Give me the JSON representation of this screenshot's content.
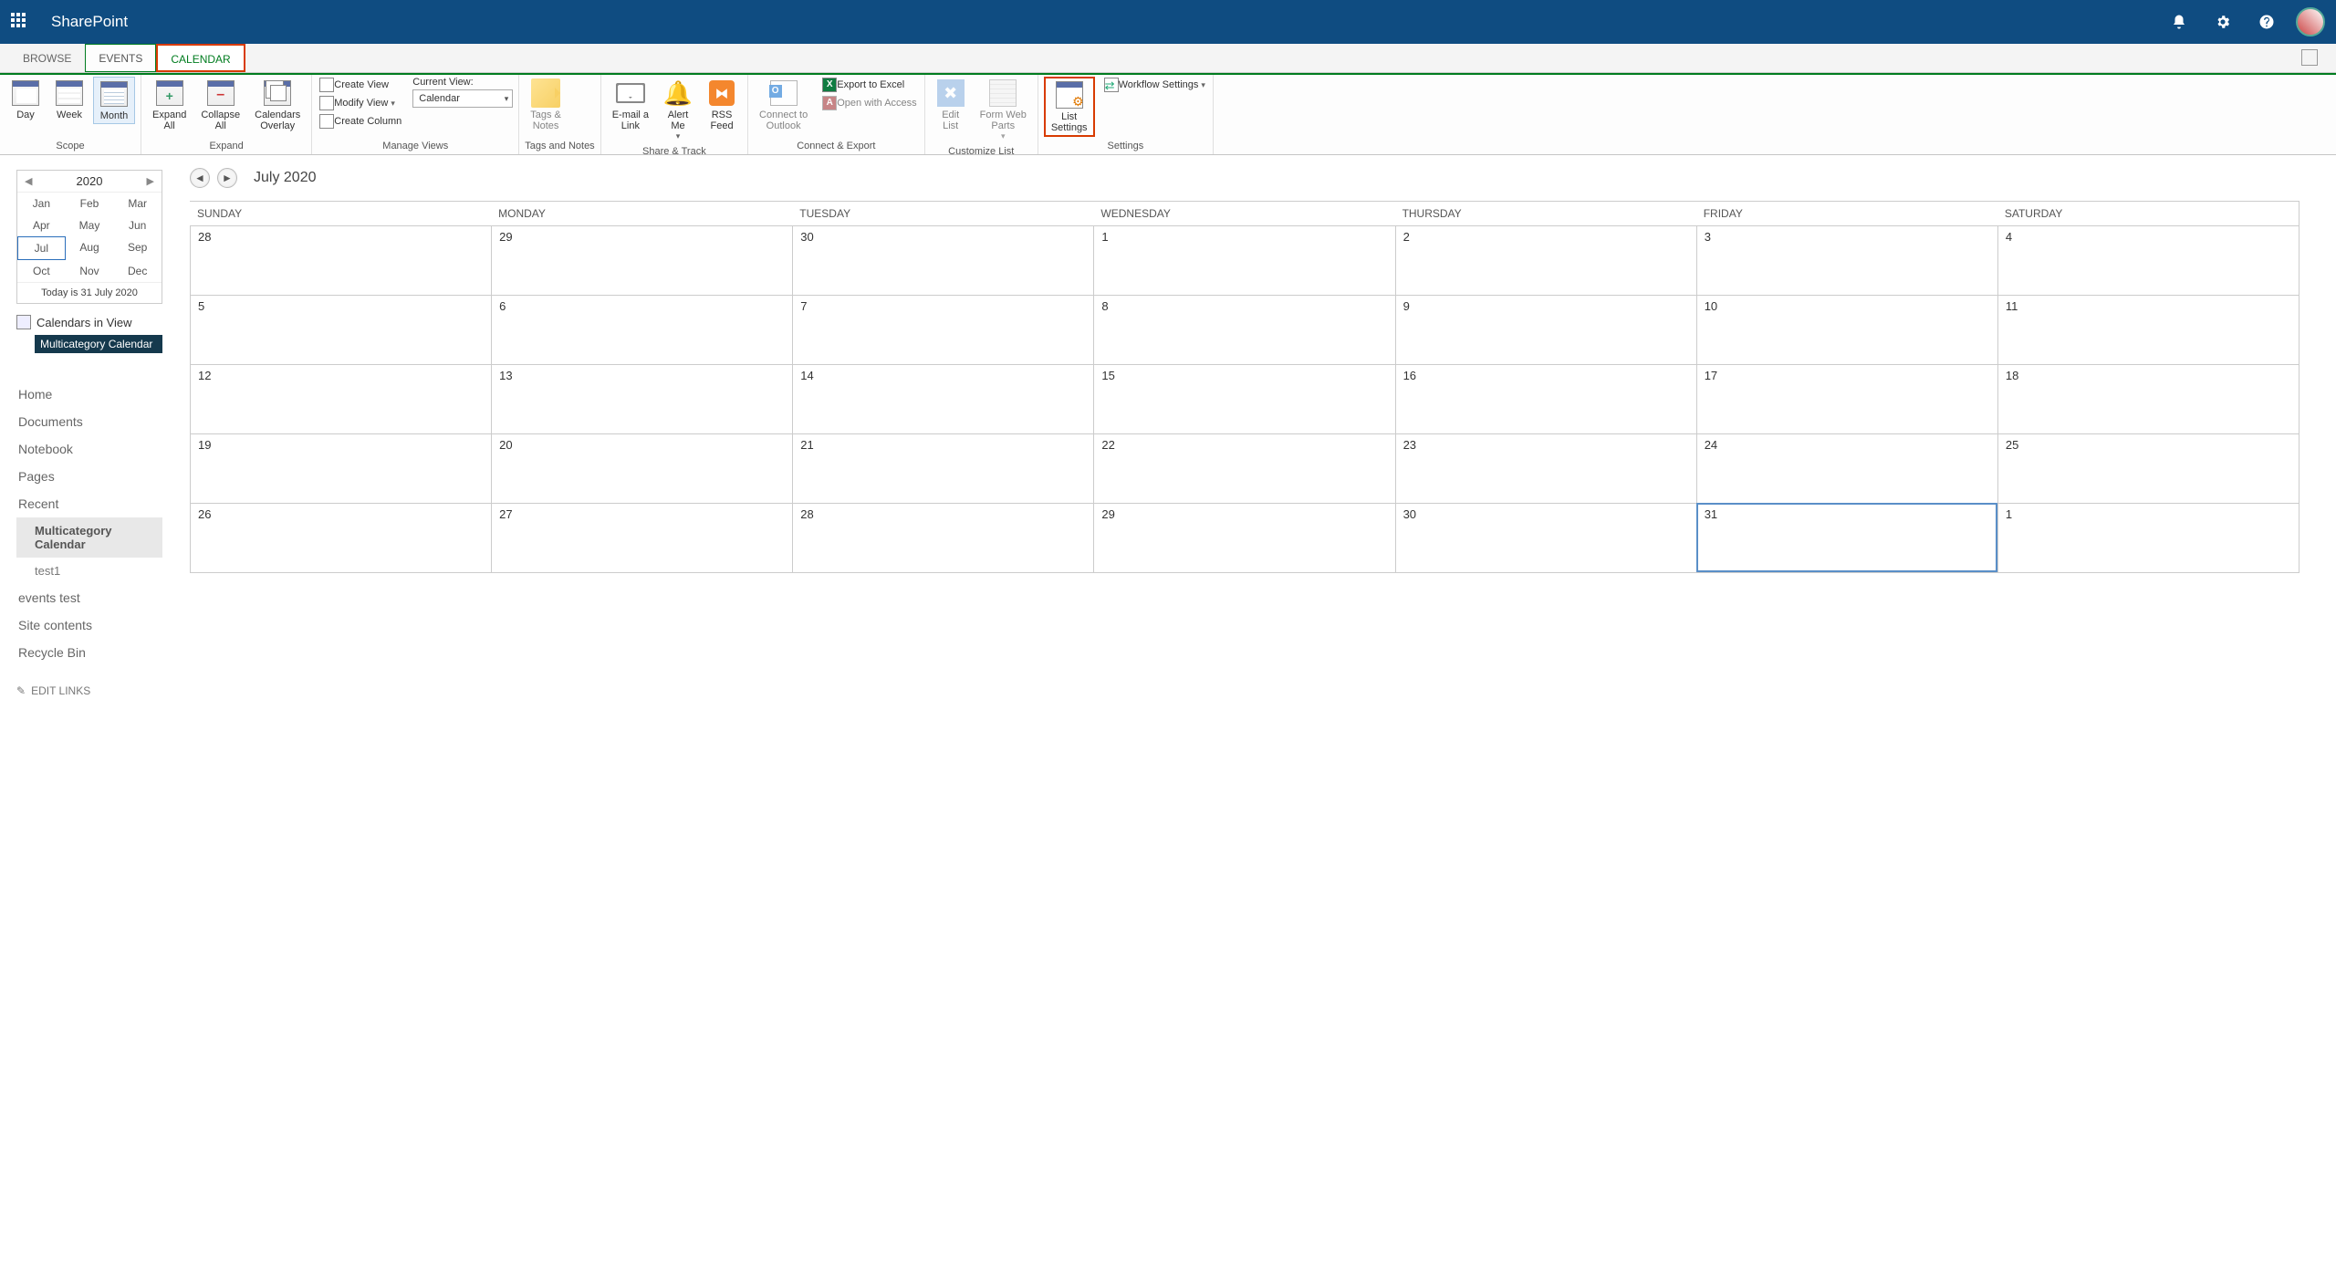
{
  "suite": {
    "title": "SharePoint"
  },
  "tabs": {
    "browse": "BROWSE",
    "events": "EVENTS",
    "calendar": "CALENDAR"
  },
  "ribbon": {
    "scope": {
      "day": "Day",
      "week": "Week",
      "month": "Month",
      "label": "Scope"
    },
    "expand": {
      "expandAll": "Expand\nAll",
      "collapseAll": "Collapse\nAll",
      "overlay": "Calendars\nOverlay",
      "label": "Expand"
    },
    "manageViews": {
      "createView": "Create View",
      "modifyView": "Modify View",
      "createColumn": "Create Column",
      "currentViewLabel": "Current View:",
      "currentView": "Calendar",
      "label": "Manage Views"
    },
    "tags": {
      "tagsNotes": "Tags &\nNotes",
      "label": "Tags and Notes"
    },
    "share": {
      "email": "E-mail a\nLink",
      "alert": "Alert\nMe",
      "rss": "RSS\nFeed",
      "label": "Share & Track"
    },
    "connect": {
      "outlook": "Connect to\nOutlook",
      "excel": "Export to Excel",
      "access": "Open with Access",
      "label": "Connect & Export"
    },
    "customize": {
      "editList": "Edit\nList",
      "formWeb": "Form Web\nParts",
      "label": "Customize List"
    },
    "settings": {
      "listSettings": "List\nSettings",
      "workflow": "Workflow Settings",
      "label": "Settings"
    }
  },
  "miniCal": {
    "year": "2020",
    "months": [
      "Jan",
      "Feb",
      "Mar",
      "Apr",
      "May",
      "Jun",
      "Jul",
      "Aug",
      "Sep",
      "Oct",
      "Nov",
      "Dec"
    ],
    "selectedIndex": 6,
    "today": "Today is 31 July 2020"
  },
  "calendarsInView": {
    "heading": "Calendars in View",
    "item": "Multicategory Calendar"
  },
  "leftnav": {
    "home": "Home",
    "documents": "Documents",
    "notebook": "Notebook",
    "pages": "Pages",
    "recent": "Recent",
    "multicat": "Multicategory Calendar",
    "test1": "test1",
    "eventsTest": "events test",
    "siteContents": "Site contents",
    "recycle": "Recycle Bin",
    "editLinks": "EDIT LINKS"
  },
  "calendar": {
    "title": "July 2020",
    "days": [
      "SUNDAY",
      "MONDAY",
      "TUESDAY",
      "WEDNESDAY",
      "THURSDAY",
      "FRIDAY",
      "SATURDAY"
    ],
    "cells": [
      "28",
      "29",
      "30",
      "1",
      "2",
      "3",
      "4",
      "5",
      "6",
      "7",
      "8",
      "9",
      "10",
      "11",
      "12",
      "13",
      "14",
      "15",
      "16",
      "17",
      "18",
      "19",
      "20",
      "21",
      "22",
      "23",
      "24",
      "25",
      "26",
      "27",
      "28",
      "29",
      "30",
      "31",
      "1"
    ],
    "todayIndex": 33
  }
}
